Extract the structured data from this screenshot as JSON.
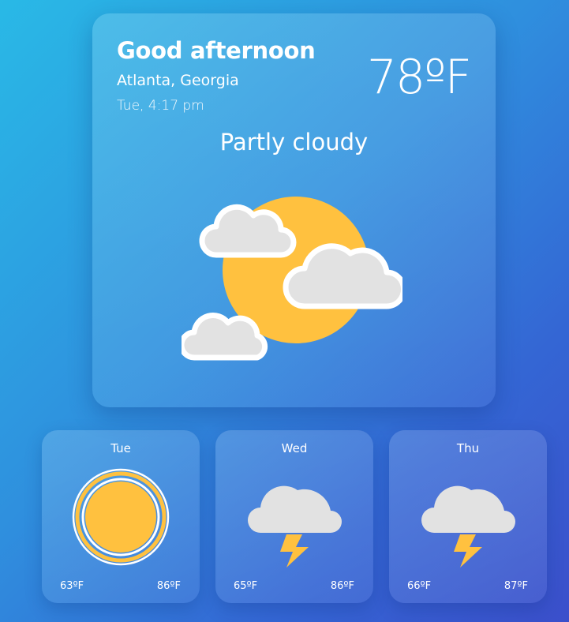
{
  "current": {
    "greeting": "Good afternoon",
    "location": "Atlanta, Georgia",
    "datetime": "Tue, 4:17 pm",
    "temperature": "78ºF",
    "condition": "Partly cloudy",
    "icon": "partly-cloudy-icon"
  },
  "forecast": [
    {
      "day": "Tue",
      "low": "63ºF",
      "high": "86ºF",
      "icon": "sunny-icon"
    },
    {
      "day": "Wed",
      "low": "65ºF",
      "high": "86ºF",
      "icon": "thunderstorm-icon"
    },
    {
      "day": "Thu",
      "low": "66ºF",
      "high": "87ºF",
      "icon": "thunderstorm-icon"
    }
  ],
  "colors": {
    "sun": "#ffc13f",
    "cloud": "#e2e2e2",
    "cloud_outline": "#ffffff",
    "lightning": "#ffc13f"
  }
}
